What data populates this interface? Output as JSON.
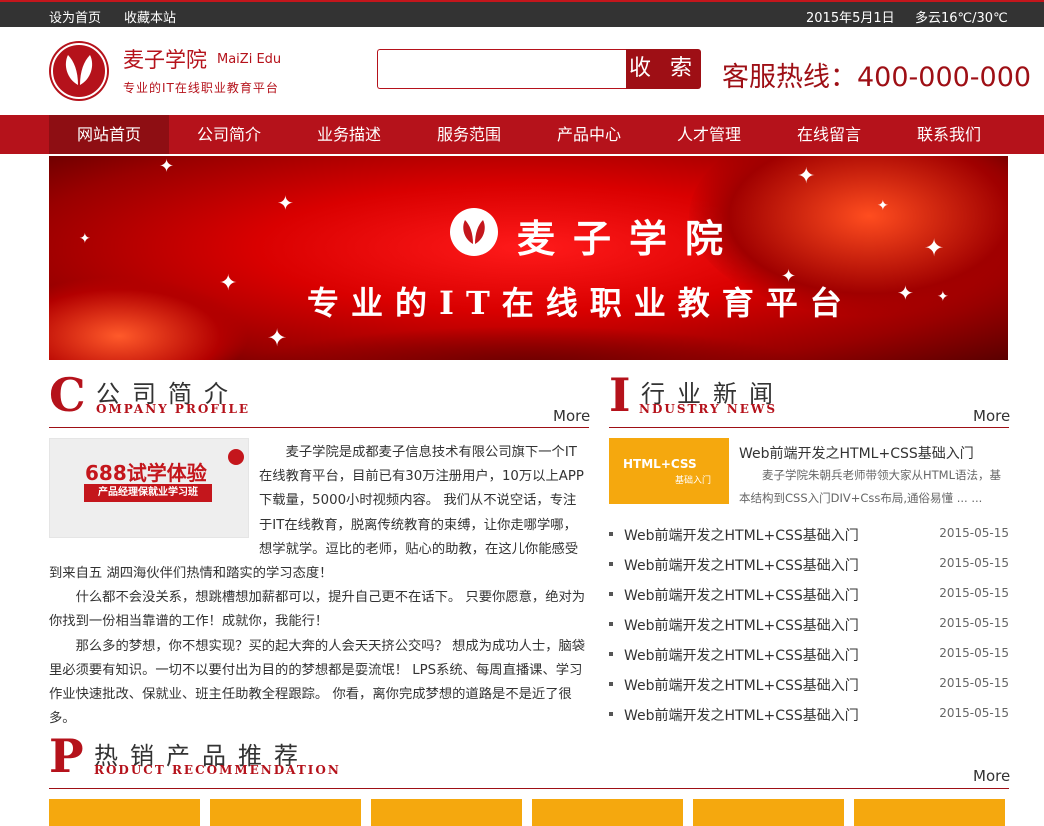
{
  "topbar": {
    "set_home": "设为首页",
    "bookmark": "收藏本站",
    "date": "2015年5月1日",
    "weather": "多云16℃/30℃"
  },
  "header": {
    "brand_cn": "麦子学院",
    "brand_en": "MaiZi Edu",
    "slogan": "专业的IT在线职业教育平台",
    "search_placeholder": "",
    "search_button": "收 索",
    "hotline": "客服热线：400-000-000"
  },
  "nav": {
    "items": [
      "网站首页",
      "公司简介",
      "业务描述",
      "服务范围",
      "产品中心",
      "人才管理",
      "在线留言",
      "联系我们"
    ],
    "active_index": 0
  },
  "banner": {
    "title": "麦子学院",
    "subtitle": "专业的IT在线职业教育平台"
  },
  "company": {
    "big_letter": "C",
    "title_cn": "公司简介",
    "title_en": "OMPANY PROFILE",
    "more": "More",
    "promo_title": "688试学体验",
    "promo_subtitle": "产品经理保就业学习班",
    "paragraphs": [
      "麦子学院是成都麦子信息技术有限公司旗下一个IT在线教育平台，目前已有30万注册用户，10万以上APP下载量，5000小时视频内容。 我们从不说空话，专注于IT在线教育，脱离传统教育的束缚，让你走哪学哪，想学就学。逗比的老师，贴心的助教，在这儿你能感受到来自五 湖四海伙伴们热情和踏实的学习态度！",
      "什么都不会没关系，想跳槽想加薪都可以，提升自己更不在话下。 只要你愿意，绝对为你找到一份相当靠谱的工作！成就你，我能行！",
      "那么多的梦想，你不想实现？买的起大奔的人会天天挤公交吗？ 想成为成功人士，脑袋里必须要有知识。一切不以要付出为目的的梦想都是耍流氓！ LPS系统、每周直播课、学习作业快速批改、保就业、班主任助教全程跟踪。 你看，离你完成梦想的道路是不是近了很多。"
    ]
  },
  "news": {
    "big_letter": "I",
    "title_cn": "行业新闻",
    "title_en": "NDUSTRY NEWS",
    "more": "More",
    "thumb_text": "HTML+CSS",
    "thumb_sub": "基础入门",
    "featured_title": "Web前端开发之HTML+CSS基础入门",
    "featured_desc": "麦子学院朱朝兵老师带领大家从HTML语法，基本结构到CSS入门DIV+Css布局,通俗易懂 ... ...",
    "items": [
      {
        "title": "Web前端开发之HTML+CSS基础入门",
        "date": "2015-05-15"
      },
      {
        "title": "Web前端开发之HTML+CSS基础入门",
        "date": "2015-05-15"
      },
      {
        "title": "Web前端开发之HTML+CSS基础入门",
        "date": "2015-05-15"
      },
      {
        "title": "Web前端开发之HTML+CSS基础入门",
        "date": "2015-05-15"
      },
      {
        "title": "Web前端开发之HTML+CSS基础入门",
        "date": "2015-05-15"
      },
      {
        "title": "Web前端开发之HTML+CSS基础入门",
        "date": "2015-05-15"
      },
      {
        "title": "Web前端开发之HTML+CSS基础入门",
        "date": "2015-05-15"
      }
    ]
  },
  "products": {
    "big_letter": "P",
    "title_cn": "热销产品推荐",
    "title_en": "RODUCT RECOMMENDATION",
    "more": "More",
    "count": 6
  },
  "colors": {
    "brand_red": "#b5121b",
    "dark_red": "#9e0f15",
    "topbar": "#333333",
    "product_orange": "#f5a80e"
  }
}
